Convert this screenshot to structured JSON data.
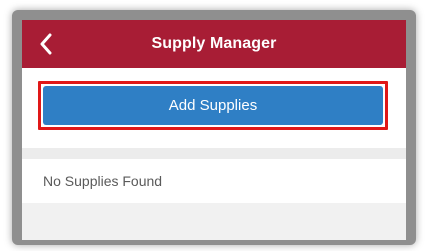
{
  "nav": {
    "title": "Supply Manager",
    "back_icon": "chevron-left-icon"
  },
  "main": {
    "add_button_label": "Add Supplies",
    "empty_message": "No Supplies Found"
  },
  "colors": {
    "nav_background": "#a81d35",
    "button_background": "#2f7fc5",
    "highlight_border": "#e01818"
  }
}
